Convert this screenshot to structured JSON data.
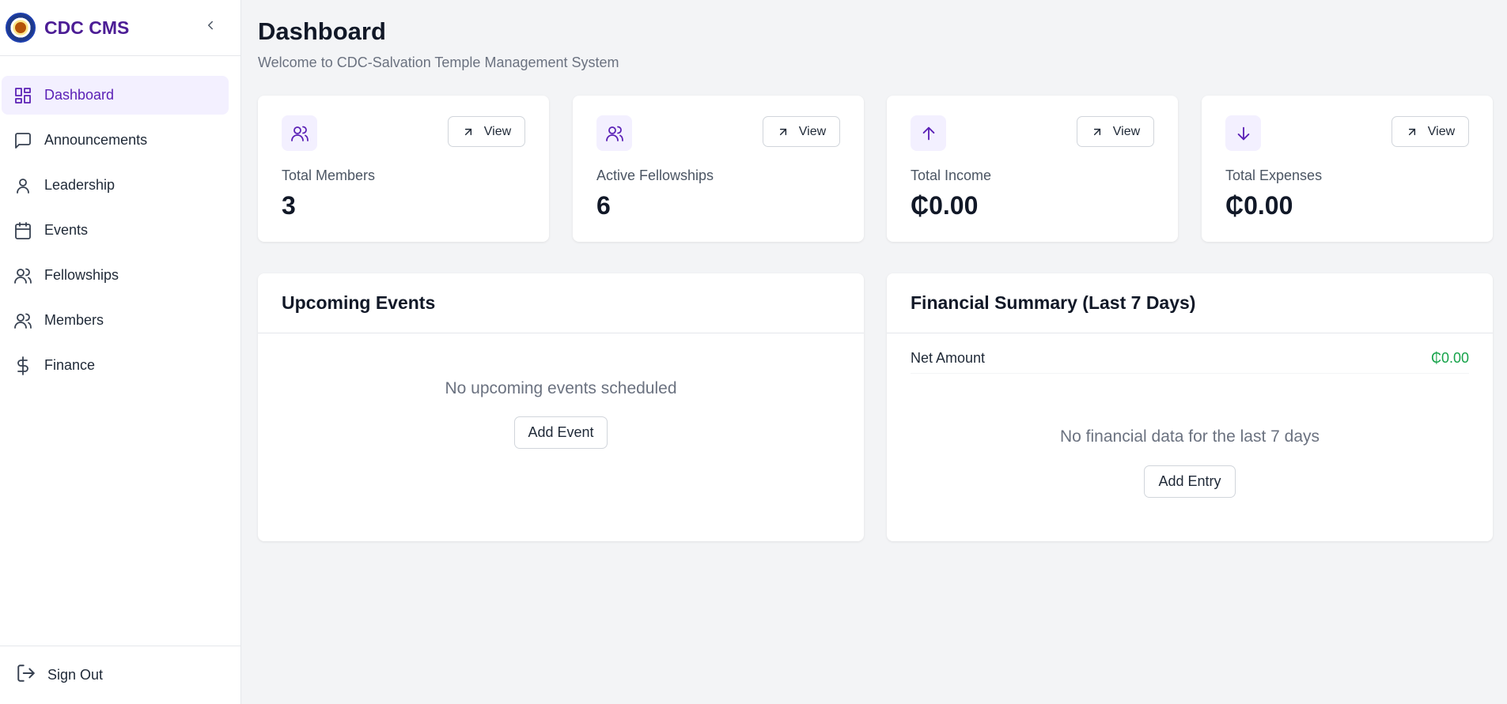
{
  "brand": {
    "name": "CDC CMS"
  },
  "sidebar": {
    "items": [
      {
        "label": "Dashboard",
        "icon": "dashboard-icon",
        "active": true
      },
      {
        "label": "Announcements",
        "icon": "message-square-icon",
        "active": false
      },
      {
        "label": "Leadership",
        "icon": "user-icon",
        "active": false
      },
      {
        "label": "Events",
        "icon": "calendar-icon",
        "active": false
      },
      {
        "label": "Fellowships",
        "icon": "users-icon",
        "active": false
      },
      {
        "label": "Members",
        "icon": "users-icon",
        "active": false
      },
      {
        "label": "Finance",
        "icon": "dollar-sign-icon",
        "active": false
      }
    ],
    "signout_label": "Sign Out"
  },
  "header": {
    "title": "Dashboard",
    "subtitle": "Welcome to CDC-Salvation Temple Management System"
  },
  "stats": [
    {
      "label": "Total Members",
      "value": "3",
      "icon": "users-icon",
      "button": "View"
    },
    {
      "label": "Active Fellowships",
      "value": "6",
      "icon": "users-icon",
      "button": "View"
    },
    {
      "label": "Total Income",
      "value": "₵0.00",
      "icon": "arrow-up-icon",
      "button": "View"
    },
    {
      "label": "Total Expenses",
      "value": "₵0.00",
      "icon": "arrow-down-icon",
      "button": "View"
    }
  ],
  "events_panel": {
    "title": "Upcoming Events",
    "empty_text": "No upcoming events scheduled",
    "button": "Add Event"
  },
  "finance_panel": {
    "title": "Financial Summary (Last 7 Days)",
    "net_label": "Net Amount",
    "net_value": "₵0.00",
    "empty_text": "No financial data for the last 7 days",
    "button": "Add Entry"
  },
  "colors": {
    "accent": "#5b21b6",
    "brand_text": "#4c1d95",
    "active_bg": "#f3f0ff",
    "positive": "#16a34a"
  }
}
